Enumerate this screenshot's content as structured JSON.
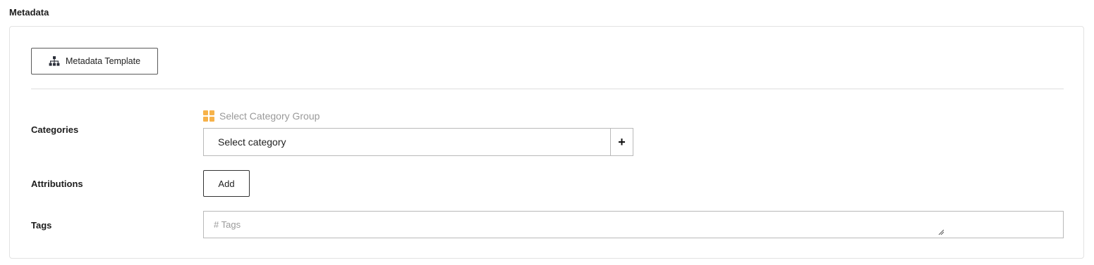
{
  "section": {
    "title": "Metadata"
  },
  "toolbar": {
    "template_button_label": "Metadata Template",
    "template_button_icon": "sitemap-icon"
  },
  "categories": {
    "label": "Categories",
    "group_link_label": "Select Category Group",
    "group_icon": "grid-icon",
    "group_icon_color": "#f6b24a",
    "select_value": "Select category",
    "add_symbol": "+"
  },
  "attributions": {
    "label": "Attributions",
    "add_button_label": "Add"
  },
  "tags": {
    "label": "Tags",
    "placeholder": "# Tags",
    "value": ""
  }
}
